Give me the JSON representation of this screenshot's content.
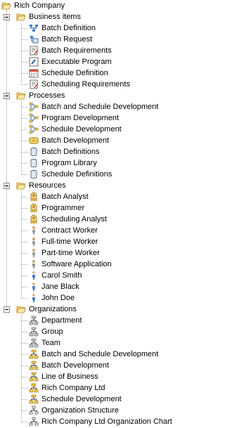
{
  "root": {
    "label": "Rich Company",
    "icon": "folder-open-icon"
  },
  "groups": [
    {
      "label": "Business items",
      "icon": "folder-open-icon",
      "items": [
        {
          "label": "Batch Definition",
          "icon": "batch-definition-icon"
        },
        {
          "label": "Batch Request",
          "icon": "batch-request-icon"
        },
        {
          "label": "Batch Requirements",
          "icon": "requirements-doc-icon"
        },
        {
          "label": "Executable Program",
          "icon": "executable-program-icon"
        },
        {
          "label": "Schedule Definition",
          "icon": "schedule-calendar-icon"
        },
        {
          "label": "Scheduling Requirements",
          "icon": "requirements-doc-icon"
        }
      ]
    },
    {
      "label": "Processes",
      "icon": "folder-open-icon",
      "items": [
        {
          "label": "Batch and Schedule Development",
          "icon": "process-flow-icon"
        },
        {
          "label": "Program Development",
          "icon": "process-flow-icon"
        },
        {
          "label": "Schedule Development",
          "icon": "process-flow-icon"
        },
        {
          "label": "Batch Development",
          "icon": "process-box-icon"
        },
        {
          "label": "Batch Definitions",
          "icon": "repository-cylinder-icon"
        },
        {
          "label": "Program Library",
          "icon": "repository-cylinder-icon"
        },
        {
          "label": "Schedule Definitions",
          "icon": "repository-cylinder-icon"
        }
      ]
    },
    {
      "label": "Resources",
      "icon": "folder-open-icon",
      "items": [
        {
          "label": "Batch Analyst",
          "icon": "role-icon"
        },
        {
          "label": "Programmer",
          "icon": "role-icon"
        },
        {
          "label": "Scheduling Analyst",
          "icon": "role-icon"
        },
        {
          "label": "Contract Worker",
          "icon": "person-gray-icon"
        },
        {
          "label": "Full-time Worker",
          "icon": "person-gray-icon"
        },
        {
          "label": "Part-time Worker",
          "icon": "person-gray-icon"
        },
        {
          "label": "Software Application",
          "icon": "person-gray-icon"
        },
        {
          "label": "Carol Smith",
          "icon": "person-blue-icon"
        },
        {
          "label": "Jane Black",
          "icon": "person-blue-icon"
        },
        {
          "label": "John Doe",
          "icon": "person-blue-icon"
        }
      ]
    },
    {
      "label": "Organizations",
      "icon": "folder-open-icon",
      "items": [
        {
          "label": "Department",
          "icon": "org-unit-icon"
        },
        {
          "label": "Group",
          "icon": "org-unit-icon"
        },
        {
          "label": "Team",
          "icon": "org-unit-icon"
        },
        {
          "label": "Batch and Schedule Development",
          "icon": "org-unit-yellow-icon"
        },
        {
          "label": "Batch Development",
          "icon": "org-unit-yellow-icon"
        },
        {
          "label": "Line of Business",
          "icon": "org-unit-yellow-icon"
        },
        {
          "label": "Rich Company Ltd",
          "icon": "org-unit-yellow-icon"
        },
        {
          "label": "Schedule Development",
          "icon": "org-unit-yellow-icon"
        },
        {
          "label": "Organization Structure",
          "icon": "org-chart-icon"
        },
        {
          "label": "Rich Company Ltd Organization Chart",
          "icon": "org-chart-icon"
        }
      ]
    }
  ]
}
